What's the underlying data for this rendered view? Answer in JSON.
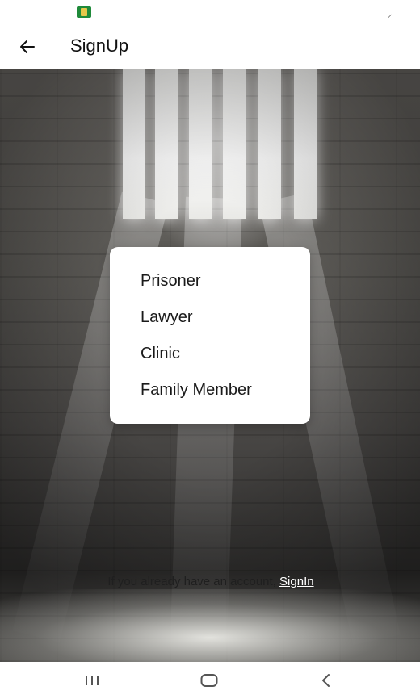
{
  "status_bar": {
    "signal_icon": "signal-icon",
    "app_notification_icon": "app-notification-icon"
  },
  "app_bar": {
    "title": "SignUp",
    "back_icon": "arrow-left-icon"
  },
  "menu": {
    "items": [
      "Prisoner",
      "Lawyer",
      "Clinic",
      "Family Member"
    ]
  },
  "signin": {
    "prompt": "If you already have an account,",
    "link": "SignIn"
  },
  "nav_bar": {
    "recents_icon": "recents-icon",
    "home_icon": "home-icon",
    "back_icon": "back-chevron-icon"
  },
  "colors": {
    "menu_bg": "#ffffff",
    "link": "#ffffff",
    "scene_dark": "#3a3937"
  }
}
